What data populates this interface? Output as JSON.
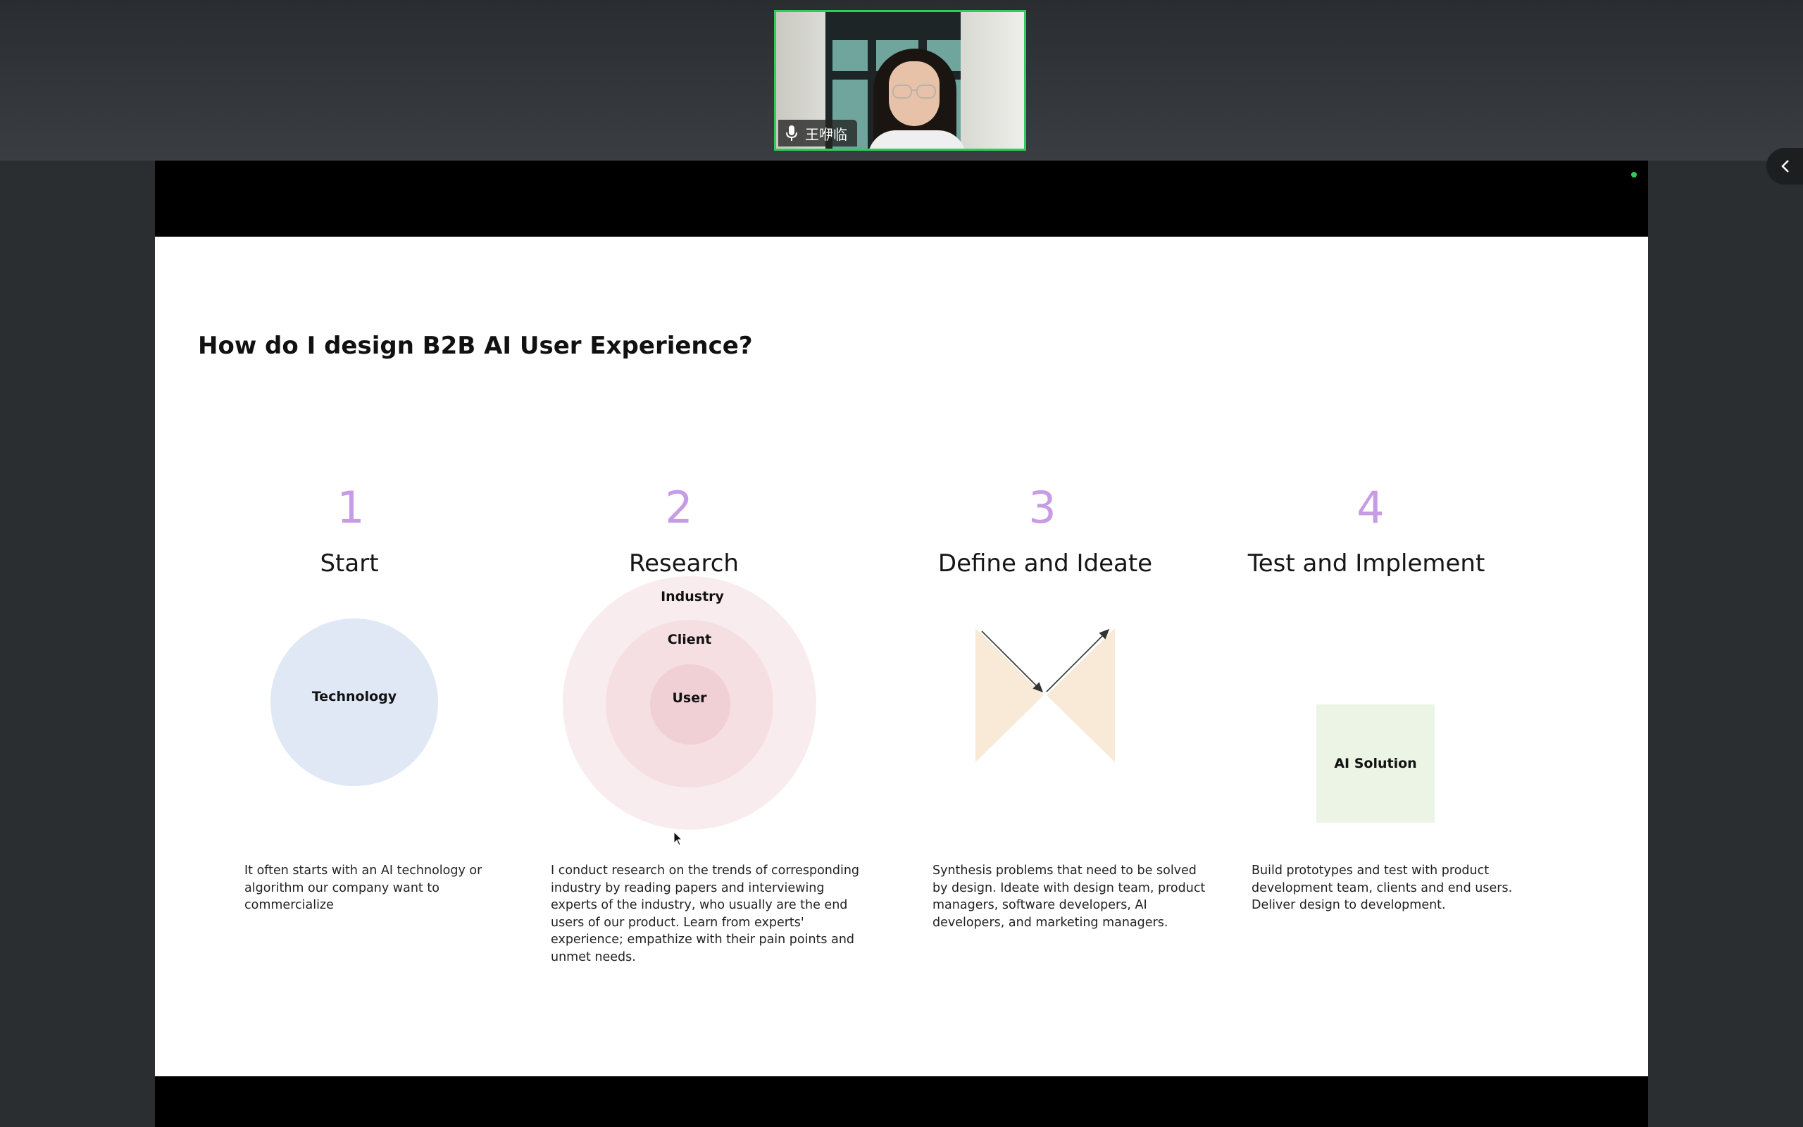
{
  "participant": {
    "name": "王咿临"
  },
  "slide": {
    "title": "How do I design B2B AI User Experience?",
    "steps": [
      {
        "number": "1",
        "name": "Start",
        "diagram_labels": [
          "Technology"
        ],
        "description": "It often starts with an AI technology or algorithm our company want to commercialize"
      },
      {
        "number": "2",
        "name": "Research",
        "diagram_labels": [
          "Industry",
          "Client",
          "User"
        ],
        "description": "I conduct research on the trends of corresponding industry by reading papers and interviewing experts of the industry, who usually are the end users of our product. Learn from experts' experience; empathize with their pain points and unmet needs."
      },
      {
        "number": "3",
        "name": "Define and Ideate",
        "diagram_labels": [],
        "description": "Synthesis problems that need to be solved by design. Ideate with design team, product managers, software developers, AI developers, and marketing managers."
      },
      {
        "number": "4",
        "name": "Test and Implement",
        "diagram_labels": [
          "AI Solution"
        ],
        "description": "Build prototypes and test with product development team, clients and end users. Deliver design to development."
      }
    ]
  },
  "colors": {
    "accent_number": "#c79ce6",
    "technology_circle": "#e0e8f6",
    "industry_ring": "#f9ecee",
    "client_ring": "#f5dfe3",
    "user_ring": "#f0cfd5",
    "define_shape": "#f8ead6",
    "ai_solution_box": "#ecf5e5",
    "video_border": "#2ecc5a"
  },
  "icons": {
    "mic": "microphone-icon",
    "collapse": "chevron-left-icon",
    "cursor": "mouse-cursor-icon"
  }
}
